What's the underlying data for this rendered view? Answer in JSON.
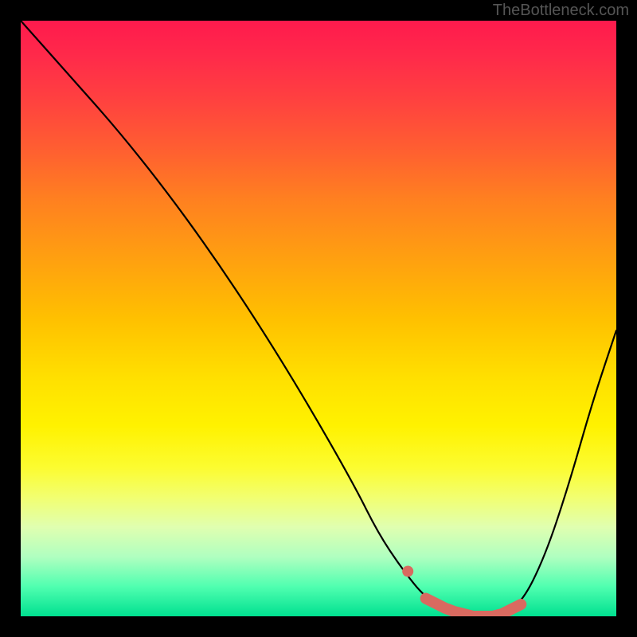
{
  "watermark": "TheBottleneck.com",
  "chart_data": {
    "type": "line",
    "title": "",
    "xlabel": "",
    "ylabel": "",
    "xlim": [
      0,
      100
    ],
    "ylim": [
      0,
      100
    ],
    "series": [
      {
        "name": "bottleneck-curve",
        "x": [
          0,
          8,
          16,
          24,
          32,
          40,
          48,
          56,
          60,
          64,
          68,
          72,
          76,
          80,
          84,
          88,
          92,
          96,
          100
        ],
        "y": [
          100,
          91,
          82,
          72,
          61,
          49,
          36,
          22,
          14,
          8,
          3,
          1,
          0,
          0,
          2,
          10,
          22,
          36,
          48
        ]
      }
    ],
    "annotations": [
      {
        "name": "optimum-range-marker",
        "x_range": [
          68,
          84
        ],
        "y": 1,
        "color": "#d96a60"
      }
    ],
    "background_gradient": {
      "top": "#ff1a4d",
      "bottom": "#00e090",
      "description": "red-to-green vertical gradient indicating bottleneck severity"
    }
  }
}
